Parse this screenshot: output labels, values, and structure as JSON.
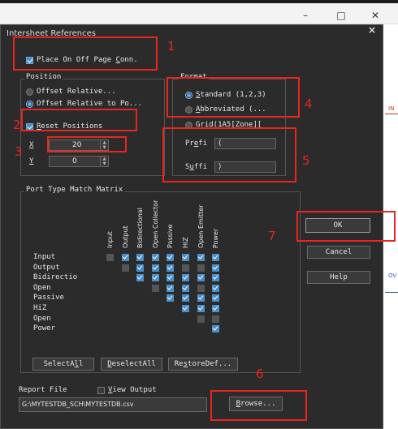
{
  "window": {
    "title": "Intersheet References",
    "minimize": "–",
    "maximize": "□",
    "close": "✕",
    "dialog_close": "×"
  },
  "place_on_off_page": {
    "label_pre": "Place On Off Page ",
    "label_u": "C",
    "label_post": "onn.",
    "checked": true
  },
  "position": {
    "title": "Position",
    "options": [
      "Offset Relative...",
      "Offset Relative to Po..."
    ],
    "selected": 1,
    "reset_pre": "",
    "reset_u": "R",
    "reset_post": "eset Positions",
    "reset_checked": true,
    "x_label": "X",
    "x_value": "20",
    "y_label": "Y",
    "y_value": "0"
  },
  "format": {
    "title": "Format",
    "options": [
      {
        "u": "S",
        "rest": "tandard (1,2,3)"
      },
      {
        "u": "A",
        "rest": "bbreviated (..."
      },
      {
        "u": "G",
        "rest": "rid(1A5[Zone]["
      }
    ],
    "selected": 0,
    "prefix_pre": "Pr",
    "prefix_u": "e",
    "prefix_post": "fi",
    "prefix_value": "(",
    "suffix_pre": "S",
    "suffix_u": "u",
    "suffix_post": "ffi",
    "suffix_value": ")"
  },
  "matrix": {
    "title": "Port Type Match Matrix",
    "columns": [
      "Input",
      "Output",
      "Bidirectional",
      "Open Collector",
      "Passive",
      "HiZ",
      "Open Emitter",
      "Power"
    ],
    "rows": [
      {
        "label": "Input",
        "cells": [
          0,
          1,
          1,
          1,
          1,
          1,
          1,
          1
        ]
      },
      {
        "label": "Output",
        "cells": [
          null,
          0,
          1,
          1,
          1,
          0,
          0,
          1
        ]
      },
      {
        "label": "Bidirectio",
        "cells": [
          null,
          null,
          1,
          1,
          1,
          1,
          1,
          1
        ]
      },
      {
        "label": "Open",
        "cells": [
          null,
          null,
          null,
          0,
          1,
          1,
          0,
          1
        ]
      },
      {
        "label": "Passive",
        "cells": [
          null,
          null,
          null,
          null,
          1,
          1,
          1,
          1
        ]
      },
      {
        "label": "HiZ",
        "cells": [
          null,
          null,
          null,
          null,
          null,
          1,
          1,
          1
        ]
      },
      {
        "label": "Open",
        "cells": [
          null,
          null,
          null,
          null,
          null,
          null,
          0,
          0
        ]
      },
      {
        "label": "Power",
        "cells": [
          null,
          null,
          null,
          null,
          null,
          null,
          null,
          1
        ]
      }
    ],
    "select_all_pre": "SelectA",
    "select_all_u": "l",
    "select_all_post": "l",
    "deselect_all_u": "D",
    "deselect_all_post": "eselectAll",
    "restore_pre": "Re",
    "restore_u": "s",
    "restore_post": "toreDef..."
  },
  "report": {
    "label": "Report File",
    "view_output_u": "V",
    "view_output_rest": "iew Output",
    "view_output_checked": false,
    "path": "G:\\MYTESTDB_SCH\\MYTESTDB.csv",
    "browse_u": "B",
    "browse_rest": "rowse..."
  },
  "buttons": {
    "ok": "OK",
    "cancel": "Cancel",
    "help": "Help"
  },
  "annotations": [
    "1",
    "2",
    "3",
    "4",
    "5",
    "6",
    "7"
  ],
  "background_links": [
    "IN",
    "OV"
  ],
  "colors": {
    "annotation_red": "#e8261f",
    "check_blue": "#4a8fc8",
    "dialog_bg": "#2b2b2b"
  }
}
